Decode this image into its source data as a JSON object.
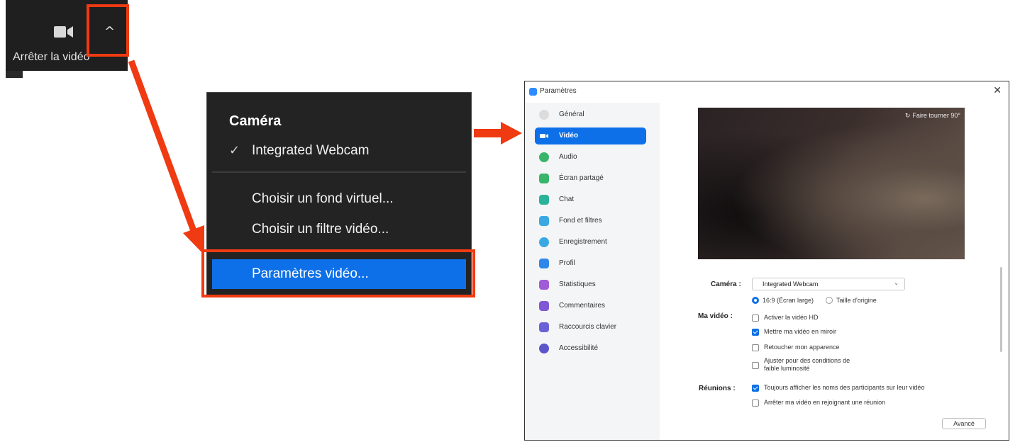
{
  "toolbar": {
    "stop_video_label": "Arrêter la vidéo",
    "camera_icon": "video-camera-icon",
    "chevron_icon": "chevron-up-icon",
    "chevron_glyph": "^"
  },
  "camera_menu": {
    "heading": "Caméra",
    "check_glyph": "✓",
    "selected_camera": "Integrated Webcam",
    "items": [
      "Choisir un fond virtuel...",
      "Choisir un filtre vidéo...",
      "Paramètres vidéo..."
    ]
  },
  "settings_window": {
    "title": "Paramètres",
    "close_glyph": "✕",
    "sidebar": [
      {
        "label": "Général",
        "icon": "gear-icon",
        "color": "#d9d9d9"
      },
      {
        "label": "Vidéo",
        "icon": "video-icon",
        "color": "#ffffff",
        "active": true
      },
      {
        "label": "Audio",
        "icon": "headphones-icon",
        "color": "#38b56a"
      },
      {
        "label": "Écran partagé",
        "icon": "share-screen-icon",
        "color": "#38b56a"
      },
      {
        "label": "Chat",
        "icon": "chat-icon",
        "color": "#2ab29a"
      },
      {
        "label": "Fond et filtres",
        "icon": "background-icon",
        "color": "#3aa9e3"
      },
      {
        "label": "Enregistrement",
        "icon": "record-icon",
        "color": "#3aa9e3"
      },
      {
        "label": "Profil",
        "icon": "profile-icon",
        "color": "#2e86e8"
      },
      {
        "label": "Statistiques",
        "icon": "stats-icon",
        "color": "#a05bd6"
      },
      {
        "label": "Commentaires",
        "icon": "feedback-icon",
        "color": "#7f58d6"
      },
      {
        "label": "Raccourcis clavier",
        "icon": "keyboard-icon",
        "color": "#6a63d8"
      },
      {
        "label": "Accessibilité",
        "icon": "accessibility-icon",
        "color": "#5a55c8"
      }
    ],
    "preview": {
      "rotate_glyph": "↻",
      "rotate_label": "Faire tourner 90°"
    },
    "camera_label": "Caméra :",
    "camera_value": "Integrated Webcam",
    "select_chevron": "⌄",
    "aspect_options": [
      {
        "label": "16:9 (Écran large)",
        "selected": true
      },
      {
        "label": "Taille d'origine",
        "selected": false
      }
    ],
    "my_video_label": "Ma vidéo :",
    "my_video_options": [
      {
        "label": "Activer la vidéo HD",
        "checked": false
      },
      {
        "label": "Mettre ma vidéo en miroir",
        "checked": true
      },
      {
        "label": "Retoucher mon apparence",
        "checked": false
      },
      {
        "label": "Ajuster pour des conditions de",
        "label2": "faible luminosité",
        "checked": false
      }
    ],
    "meetings_label": "Réunions :",
    "meeting_options": [
      {
        "label": "Toujours afficher les noms des participants sur leur vidéo",
        "checked": true
      },
      {
        "label": "Arrêter ma vidéo en rejoignant une réunion",
        "checked": false
      }
    ],
    "advanced_label": "Avancé"
  },
  "colors": {
    "annotation_red": "#ef3a12",
    "zoom_blue": "#0e70e8"
  }
}
